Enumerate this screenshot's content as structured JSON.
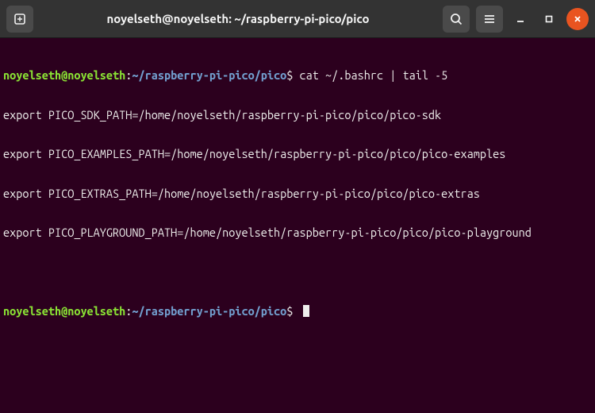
{
  "titlebar": {
    "title": "noyelseth@noyelseth: ~/raspberry-pi-pico/pico"
  },
  "terminal": {
    "prompt1": {
      "user_host": "noyelseth@noyelseth",
      "colon": ":",
      "path": "~/raspberry-pi-pico/pico",
      "dollar": "$",
      "command": " cat ~/.bashrc | tail -5"
    },
    "output": [
      "export PICO_SDK_PATH=/home/noyelseth/raspberry-pi-pico/pico/pico-sdk",
      "export PICO_EXAMPLES_PATH=/home/noyelseth/raspberry-pi-pico/pico/pico-examples",
      "export PICO_EXTRAS_PATH=/home/noyelseth/raspberry-pi-pico/pico/pico-extras",
      "export PICO_PLAYGROUND_PATH=/home/noyelseth/raspberry-pi-pico/pico/pico-playground"
    ],
    "prompt2": {
      "user_host": "noyelseth@noyelseth",
      "colon": ":",
      "path": "~/raspberry-pi-pico/pico",
      "dollar": "$",
      "command": " "
    }
  }
}
